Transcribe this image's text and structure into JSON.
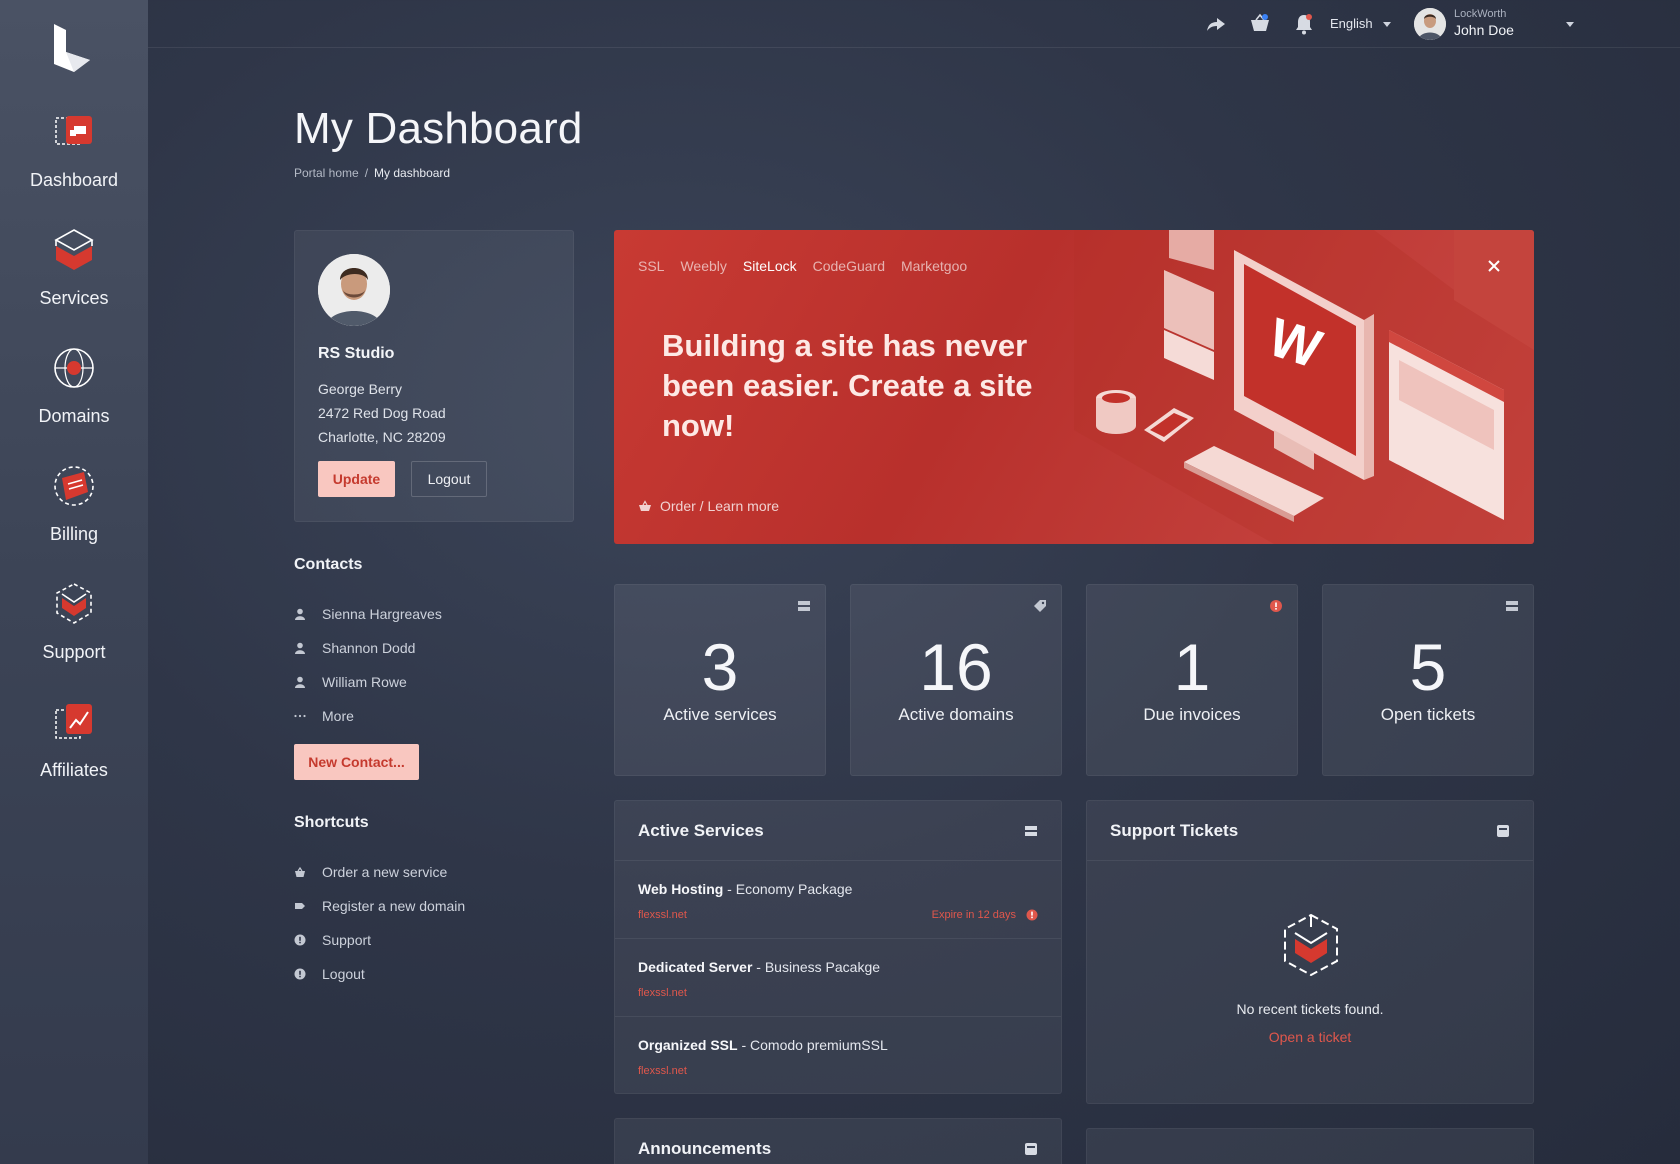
{
  "sidebar": {
    "items": [
      {
        "label": "Dashboard",
        "icon": "dashboard-icon"
      },
      {
        "label": "Services",
        "icon": "services-icon"
      },
      {
        "label": "Domains",
        "icon": "domains-icon"
      },
      {
        "label": "Billing",
        "icon": "billing-icon"
      },
      {
        "label": "Support",
        "icon": "support-icon"
      },
      {
        "label": "Affiliates",
        "icon": "affiliates-icon"
      }
    ]
  },
  "topbar": {
    "language": "English",
    "company": "LockWorth",
    "user_name": "John Doe",
    "icons": [
      "share-icon",
      "cart-icon",
      "bell-icon"
    ]
  },
  "header": {
    "title": "My Dashboard",
    "breadcrumb": {
      "home": "Portal home",
      "sep": "/",
      "current": "My dashboard"
    }
  },
  "profile": {
    "org": "RS Studio",
    "name": "George Berry",
    "street": "2472 Red Dog Road",
    "city": "Charlotte, NC 28209",
    "update_label": "Update",
    "logout_label": "Logout"
  },
  "contacts": {
    "title": "Contacts",
    "items": [
      "Sienna Hargreaves",
      "Shannon Dodd",
      "William Rowe"
    ],
    "more": "More",
    "new_label": "New Contact..."
  },
  "shortcuts": {
    "title": "Shortcuts",
    "items": [
      "Order a new service",
      "Register a new domain",
      "Support",
      "Logout"
    ]
  },
  "banner": {
    "tabs": [
      "SSL",
      "Weebly",
      "SiteLock",
      "CodeGuard",
      "Marketgoo"
    ],
    "active_tab": "SiteLock",
    "headline": "Building a site has never been easier. Create a site now!",
    "cta": "Order / Learn more"
  },
  "stats": [
    {
      "value": "3",
      "label": "Active services"
    },
    {
      "value": "16",
      "label": "Active domains"
    },
    {
      "value": "1",
      "label": "Due invoices"
    },
    {
      "value": "5",
      "label": "Open tickets"
    }
  ],
  "active_services": {
    "title": "Active Services",
    "rows": [
      {
        "name": "Web Hosting",
        "plan": " - Economy Package",
        "domain": "flexssl.net",
        "expire": "Expire in 12 days"
      },
      {
        "name": "Dedicated Server",
        "plan": " - Business Pacakge",
        "domain": "flexssl.net"
      },
      {
        "name": "Organized SSL",
        "plan": " - Comodo premiumSSL",
        "domain": "flexssl.net"
      }
    ]
  },
  "support_tickets": {
    "title": "Support Tickets",
    "empty": "No recent tickets found.",
    "open_link": "Open a ticket"
  },
  "announcements": {
    "title": "Announcements"
  },
  "colors": {
    "accent": "#c83a33",
    "accent_light": "#f9c7c0",
    "link_red": "#e0574c"
  }
}
